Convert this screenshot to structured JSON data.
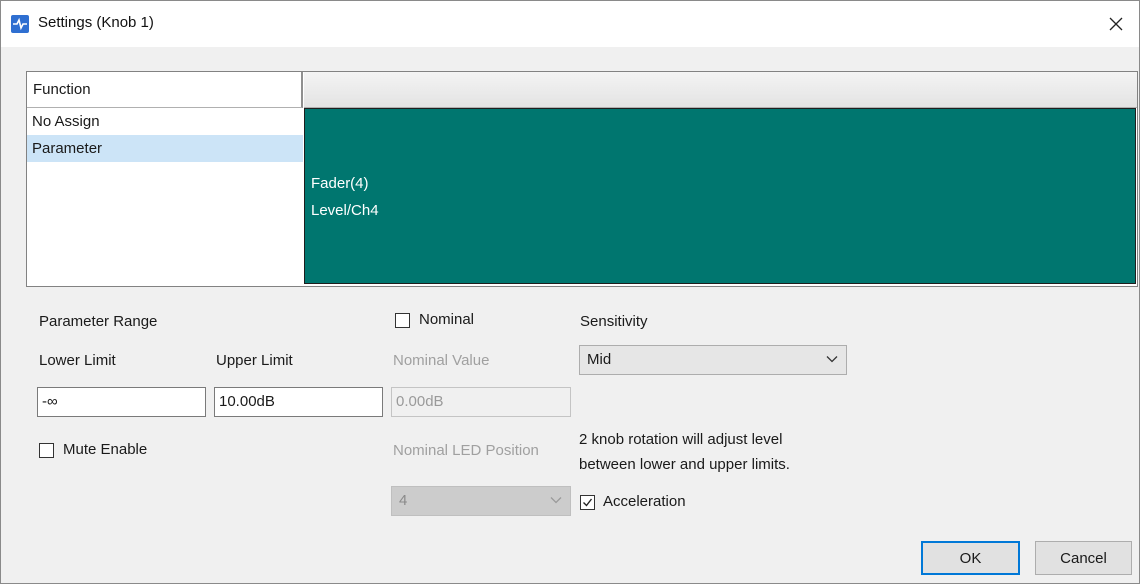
{
  "window": {
    "title": "Settings (Knob 1)"
  },
  "function_table": {
    "header": "Function",
    "items": [
      {
        "label": "No Assign",
        "selected": false
      },
      {
        "label": "Parameter",
        "selected": true
      }
    ],
    "detail": {
      "line1": "Fader(4)",
      "line2": "Level/Ch4",
      "color": "#00766f"
    }
  },
  "parameter_range": {
    "heading": "Parameter Range",
    "lower_label": "Lower Limit",
    "lower_value": "-∞",
    "upper_label": "Upper Limit",
    "upper_value": "10.00dB"
  },
  "nominal": {
    "checkbox_label": "Nominal",
    "checked": false,
    "value_label": "Nominal Value",
    "value": "0.00dB",
    "led_label": "Nominal LED Position",
    "led_value": "4"
  },
  "sensitivity": {
    "label": "Sensitivity",
    "value": "Mid",
    "note_line1": "2 knob rotation will adjust level",
    "note_line2": "between lower and upper limits."
  },
  "mute_enable": {
    "label": "Mute Enable",
    "checked": false
  },
  "acceleration": {
    "label": "Acceleration",
    "checked": true
  },
  "buttons": {
    "ok": "OK",
    "cancel": "Cancel"
  },
  "icons": {
    "app": "app-icon",
    "close": "close-icon",
    "dropdown": "chevron-down-icon",
    "check": "checkmark-icon"
  },
  "colors": {
    "accent": "#0078d7",
    "selection": "#cce4f7",
    "detail_bg": "#00766f"
  }
}
